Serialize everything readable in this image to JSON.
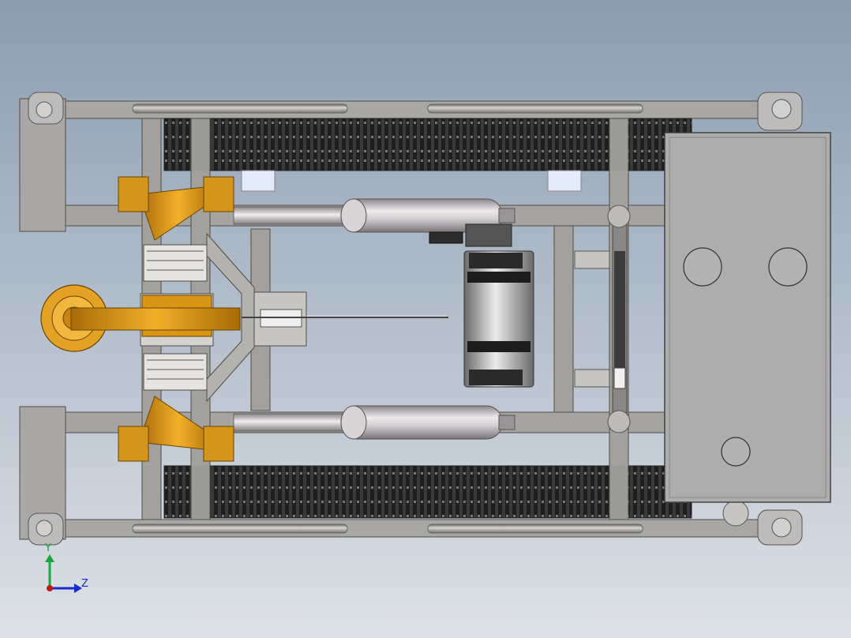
{
  "viewport": {
    "background_top": "#8b9db0",
    "background_bottom": "#dde1e7",
    "colors": {
      "frame_steel": "#a8a6a3",
      "frame_dark": "#5c5a57",
      "belt_dark": "#2a2a2a",
      "brass": "#d8930f",
      "brass_dark": "#8c5a06",
      "cylinder": "#c8c3c6",
      "panel": "#aeaeae",
      "light_blue": "#dfe8f4"
    }
  },
  "triad": {
    "y_label": "Y",
    "z_label": "Z",
    "y_color": "#1aa63a",
    "z_color": "#1a2ad0",
    "origin_color": "#c01818"
  }
}
